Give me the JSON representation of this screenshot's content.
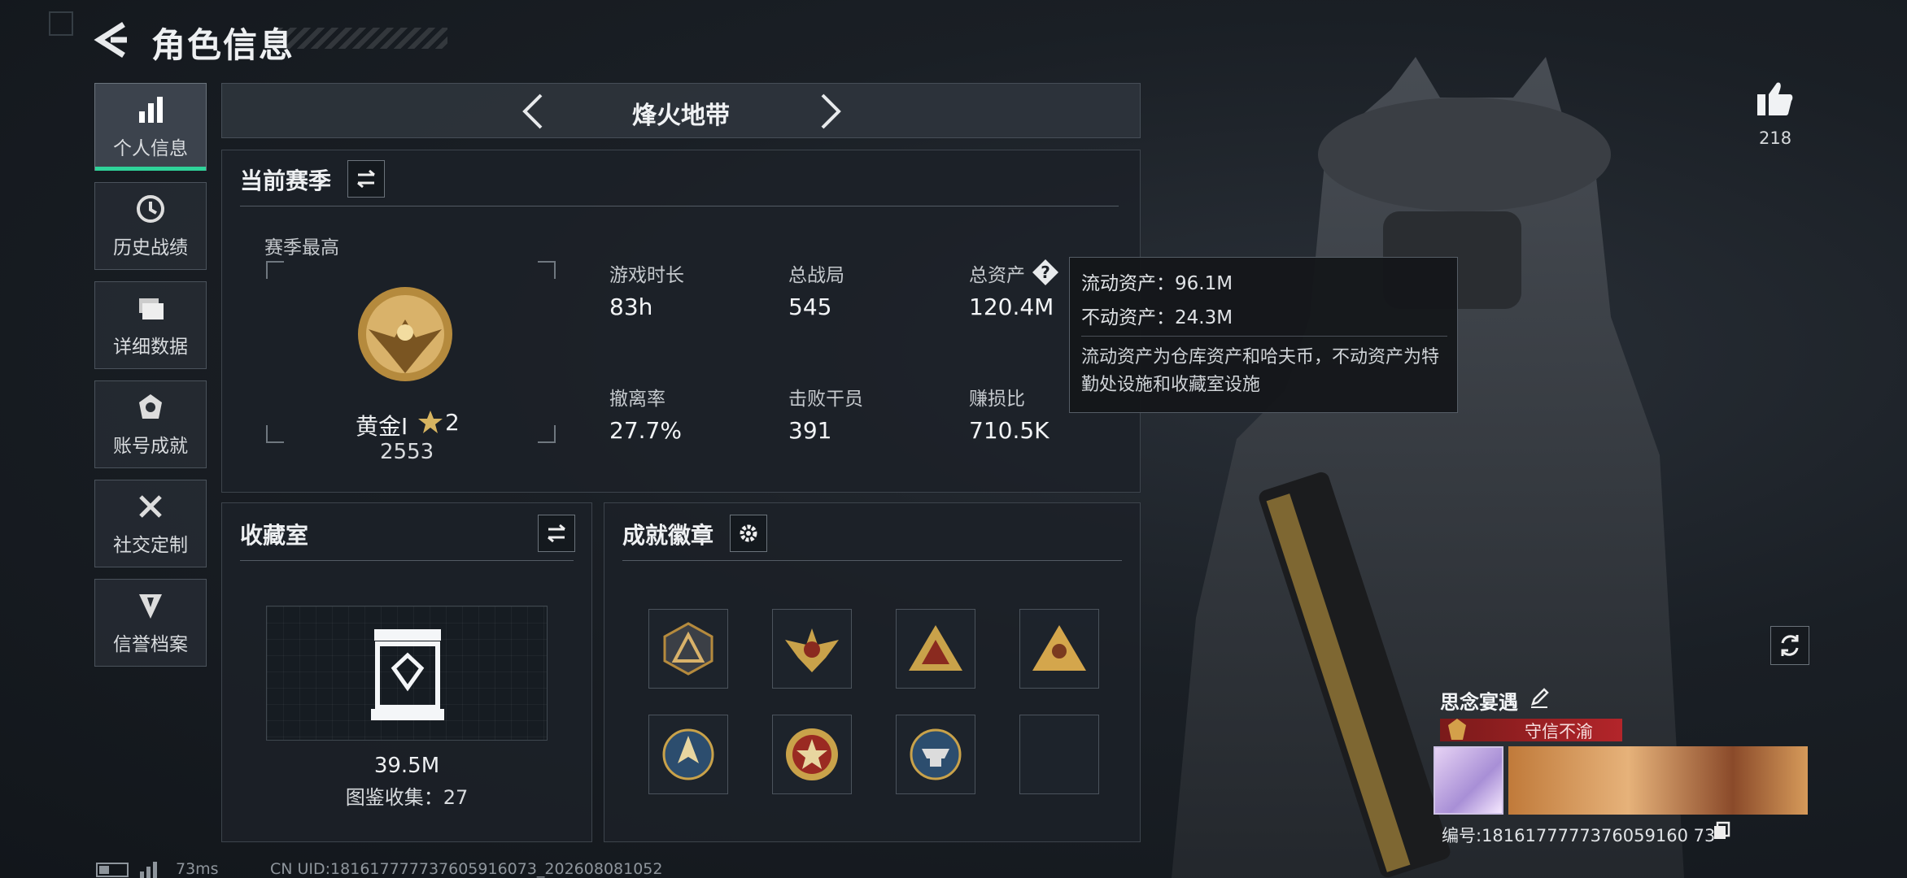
{
  "page": {
    "title": "角色信息"
  },
  "nav": [
    {
      "label": "个人信息",
      "icon": "bar-chart-icon",
      "active": true
    },
    {
      "label": "历史战绩",
      "icon": "history-clock-icon",
      "active": false
    },
    {
      "label": "详细数据",
      "icon": "folder-icon",
      "active": false
    },
    {
      "label": "账号成就",
      "icon": "achievement-icon",
      "active": false
    },
    {
      "label": "社交定制",
      "icon": "tools-icon",
      "active": false
    },
    {
      "label": "信誉档案",
      "icon": "credit-shield-icon",
      "active": false
    }
  ],
  "mode": {
    "name": "烽火地带"
  },
  "season": {
    "title": "当前赛季",
    "peak_label": "赛季最高",
    "rank_name": "黄金I",
    "rank_stars": "2",
    "rank_score": "2553",
    "stats": [
      {
        "label": "游戏时长",
        "value": "83h"
      },
      {
        "label": "总战局",
        "value": "545"
      },
      {
        "label": "总资产",
        "value": "120.4M"
      },
      {
        "label": "撤离率",
        "value": "27.7%"
      },
      {
        "label": "击败干员",
        "value": "391"
      },
      {
        "label": "赚损比",
        "value": "710.5K"
      }
    ]
  },
  "tooltip": {
    "liquid": "流动资产：96.1M",
    "fixed": "不动资产：24.3M",
    "note": "流动资产为仓库资产和哈夫币，不动资产为特勤处设施和收藏室设施"
  },
  "collection": {
    "title": "收藏室",
    "value": "39.5M",
    "catalog": "图鉴收集：27"
  },
  "badges": {
    "title": "成就徽章",
    "items": [
      "triangle-badge-icon",
      "eagle-crest-badge-icon",
      "triangle-gold-badge-icon",
      "triangle-runner-badge-icon",
      "arrow-circle-badge-icon",
      "star-medal-badge-icon",
      "anvil-badge-icon",
      "empty-badge-slot"
    ]
  },
  "social": {
    "likes": "218",
    "player_name": "思念宴遇",
    "player_title": "守信不渝",
    "player_id": "编号:1816177777376059160 73"
  },
  "status": {
    "ping": "73ms",
    "uid": "CN UID:181617777737605916073_202608081052"
  },
  "colors": {
    "accent": "#2fd39a",
    "gold": "#c9a24a",
    "title_red": "#b3252a"
  }
}
